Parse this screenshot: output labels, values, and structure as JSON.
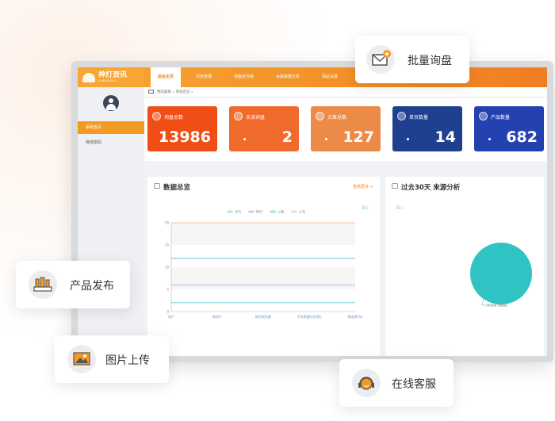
{
  "logo": {
    "text": "神灯资讯",
    "subtext": "SHENDENG"
  },
  "nav": [
    {
      "label": "后台主页",
      "active": true
    },
    {
      "label": "内容管理",
      "active": false
    },
    {
      "label": "询盘收件箱",
      "active": false
    },
    {
      "label": "谷歌数据分析",
      "active": false
    },
    {
      "label": "网站设置",
      "active": false
    }
  ],
  "sidebar": [
    {
      "label": "系统首页",
      "active": true
    },
    {
      "label": "修改密码",
      "active": false
    }
  ],
  "breadcrumb": "我的面板 » 系统首页 »",
  "stats": [
    {
      "label": "询盘总数",
      "value": "13986",
      "color": "#f04e14"
    },
    {
      "label": "未读询盘",
      "value": "2",
      "color": "#f06a2c"
    },
    {
      "label": "文章总数",
      "value": "127",
      "color": "#ec8a48"
    },
    {
      "label": "单页数量",
      "value": "14",
      "color": "#1f3f8f"
    },
    {
      "label": "产品数量",
      "value": "682",
      "color": "#2342b0"
    }
  ],
  "panel_left": {
    "title": "数据总览",
    "more": "查看更多 >"
  },
  "panel_right": {
    "title": "过去30天 来源分析"
  },
  "chart_data": [
    {
      "type": "line",
      "categories": [
        "用户",
        "新用户",
        "网页浏览量",
        "平均停留时长(秒)",
        "跳出率(%)"
      ],
      "ylim": [
        0,
        20
      ],
      "yticks": [
        0,
        5,
        10,
        15,
        20
      ],
      "grid": true,
      "legend": "top",
      "series": [
        {
          "name": "今日",
          "color": "#6ec6e0",
          "values": [
            2,
            2,
            2,
            2,
            2
          ]
        },
        {
          "name": "昨日",
          "color": "#a99be0",
          "values": [
            6,
            6,
            6,
            6,
            6
          ]
        },
        {
          "name": "上周",
          "color": "#56bcd8",
          "values": [
            12,
            12,
            12,
            12,
            12
          ]
        },
        {
          "name": "上月",
          "color": "#f4b27e",
          "values": [
            20,
            20,
            20,
            20,
            20
          ]
        }
      ]
    },
    {
      "type": "pie",
      "categories": [
        "United States"
      ],
      "values": [
        100
      ],
      "colors": [
        "#2fc3c4"
      ]
    }
  ],
  "cards": [
    {
      "label": "批量询盘",
      "icon": "envelope-plus-icon"
    },
    {
      "label": "产品发布",
      "icon": "products-shelf-icon"
    },
    {
      "label": "图片上传",
      "icon": "image-icon"
    },
    {
      "label": "在线客服",
      "icon": "headset-icon"
    }
  ]
}
